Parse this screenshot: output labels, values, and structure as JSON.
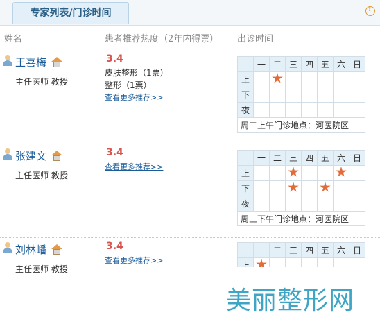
{
  "tab_title": "专家列表/门诊时间",
  "headers": {
    "name": "姓名",
    "rating": "患者推荐热度（2年内得票）",
    "schedule": "出诊时间"
  },
  "days": [
    "一",
    "二",
    "三",
    "四",
    "五",
    "六",
    "日"
  ],
  "periods": [
    "上",
    "下",
    "夜"
  ],
  "doctors": [
    {
      "name": "王喜梅",
      "title": "主任医师  教授",
      "score": "3.4",
      "recommendations": [
        "皮肤整形（1票）",
        "整形（1票）"
      ],
      "more": "查看更多推荐>>",
      "location": "周二上午门诊地点：河医院区"
    },
    {
      "name": "张建文",
      "title": "主任医师  教授",
      "score": "3.4",
      "recommendations": [],
      "more": "查看更多推荐>>",
      "location": "周三下午门诊地点：河医院区"
    },
    {
      "name": "刘林嶓",
      "title": "主任医师  教授",
      "score": "3.4",
      "recommendations": [],
      "more": "查看更多推荐>>",
      "location": ""
    }
  ],
  "watermark": "美丽整形网",
  "colors": {
    "accent": "#1a5c9a",
    "score": "#d9534f",
    "star": "#e36b3a",
    "header_bg": "#e4f0f8"
  }
}
